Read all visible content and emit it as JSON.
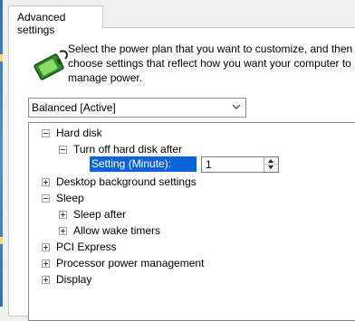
{
  "tab": {
    "label": "Advanced settings"
  },
  "description": "Select the power plan that you want to customize, and then choose settings that reflect how you want your computer to manage power.",
  "plan_select": {
    "value": "Balanced [Active]"
  },
  "tree": {
    "hard_disk": "Hard disk",
    "turn_off_hard_disk": "Turn off hard disk after",
    "setting_label": "Setting (Minute):",
    "setting_value": "1",
    "desktop_background": "Desktop background settings",
    "sleep": "Sleep",
    "sleep_after": "Sleep after",
    "allow_wake_timers": "Allow wake timers",
    "pci_express": "PCI Express",
    "processor_power": "Processor power management",
    "display": "Display"
  },
  "colors": {
    "selection": "#0a64d8",
    "panel_bg": "#ffffff",
    "window_bg": "#f0f0f0"
  }
}
